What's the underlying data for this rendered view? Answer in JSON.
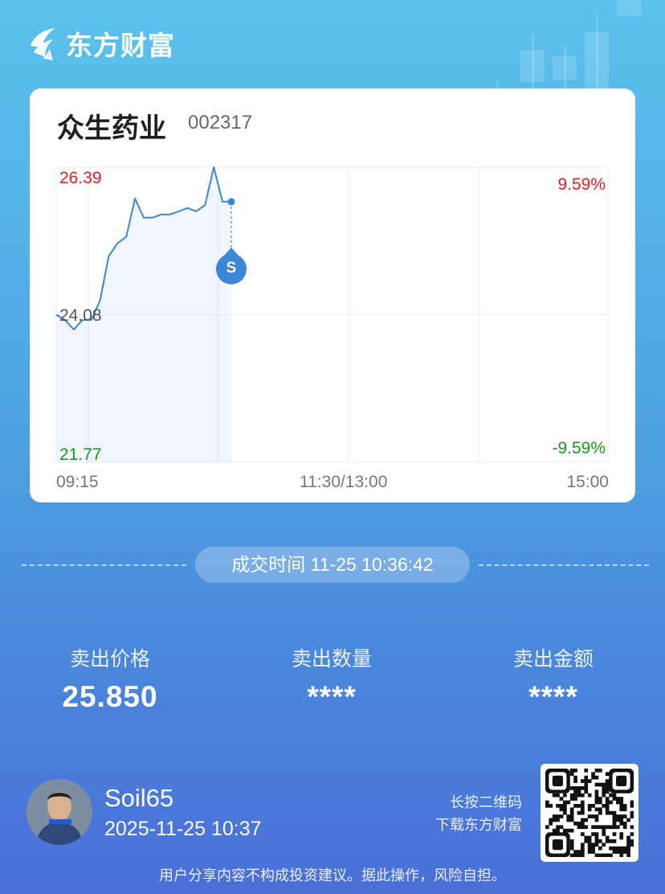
{
  "brand": {
    "name": "东方财富"
  },
  "stock": {
    "name": "众生药业",
    "code": "002317"
  },
  "chart_data": {
    "type": "line",
    "title": "",
    "xlabel": "",
    "ylabel": "",
    "ylim": [
      21.77,
      26.39
    ],
    "prev_close": 24.08,
    "y_tick_labels": {
      "high": "26.39",
      "mid": "24.08",
      "low": "21.77"
    },
    "pct_labels": {
      "high": "9.59%",
      "low": "-9.59%"
    },
    "x_tick_labels": [
      "09:15",
      "11:30/13:00",
      "15:00"
    ],
    "series": [
      {
        "values": [
          24.08,
          24.0,
          23.85,
          24.0,
          24.0,
          24.3,
          25.0,
          25.2,
          25.3,
          25.9,
          25.6,
          25.6,
          25.65,
          25.65,
          25.7,
          25.75,
          25.7,
          25.8,
          26.39,
          25.85,
          25.85
        ]
      }
    ],
    "sell_marker": {
      "label": "S",
      "price": 25.85
    }
  },
  "trade_time": "成交时间 11-25 10:36:42",
  "stats": [
    {
      "label": "卖出价格",
      "value": "25.850"
    },
    {
      "label": "卖出数量",
      "value": "****"
    },
    {
      "label": "卖出金额",
      "value": "****"
    }
  ],
  "user": {
    "name": "Soil65",
    "time": "2025-11-25 10:37"
  },
  "qr": {
    "line1": "长按二维码",
    "line2": "下载东方财富"
  },
  "disclaimer": "用户分享内容不构成投资建议。据此操作，风险自担。",
  "colors": {
    "up": "#e02020",
    "down": "#1a9a1a",
    "line": "#3b86d8",
    "marker": "#3b86d8"
  },
  "icons": {
    "brand": "eastmoney-logo-icon",
    "avatar": "user-avatar",
    "qr": "qr-code"
  }
}
